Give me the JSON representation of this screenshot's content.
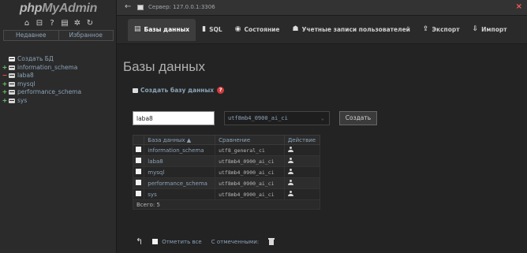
{
  "sidebar": {
    "logo": {
      "main": "php",
      "accent": "MyAdmin"
    },
    "nav_icons": [
      "home-icon",
      "logout-icon",
      "help-icon",
      "docs-icon",
      "settings-icon",
      "reload-icon"
    ],
    "tabs": [
      {
        "label": "Недавнее"
      },
      {
        "label": "Избранное"
      }
    ],
    "tree": [
      {
        "label": "Создать БД",
        "expander": "",
        "kind": "new"
      },
      {
        "label": "information_schema",
        "expander": "+",
        "kind": "db"
      },
      {
        "label": "laba8",
        "expander": "−",
        "kind": "db"
      },
      {
        "label": "mysql",
        "expander": "+",
        "kind": "db"
      },
      {
        "label": "performance_schema",
        "expander": "+",
        "kind": "db"
      },
      {
        "label": "sys",
        "expander": "+",
        "kind": "db"
      }
    ]
  },
  "topbar": {
    "server": "Сервер: 127.0.0.1:3306"
  },
  "tabs": [
    {
      "label": "Базы данных",
      "icon": "database-icon",
      "active": true
    },
    {
      "label": "SQL",
      "icon": "sql-icon",
      "active": false
    },
    {
      "label": "Состояние",
      "icon": "status-icon",
      "active": false
    },
    {
      "label": "Учетные записи пользователей",
      "icon": "users-icon",
      "active": false
    },
    {
      "label": "Экспорт",
      "icon": "export-icon",
      "active": false
    },
    {
      "label": "Импорт",
      "icon": "import-icon",
      "active": false
    }
  ],
  "main": {
    "title": "Базы данных",
    "create_db": {
      "label": "Создать базу данных",
      "name_value": "laba8",
      "collation": "utf8mb4_0900_ai_ci",
      "button": "Создать"
    },
    "table": {
      "headers": {
        "name": "База данных",
        "sort_mark": "▲",
        "collation": "Сравнение",
        "action": "Действие"
      },
      "rows": [
        {
          "name": "information_schema",
          "collation": "utf8_general_ci"
        },
        {
          "name": "laba8",
          "collation": "utf8mb4_0900_ai_ci"
        },
        {
          "name": "mysql",
          "collation": "utf8mb4_0900_ai_ci"
        },
        {
          "name": "performance_schema",
          "collation": "utf8mb4_0900_ai_ci"
        },
        {
          "name": "sys",
          "collation": "utf8mb4_0900_ai_ci"
        }
      ],
      "total": "Всего: 5"
    },
    "footer": {
      "check_all": "Отметить все",
      "with_selected": "С отмеченными:"
    }
  }
}
